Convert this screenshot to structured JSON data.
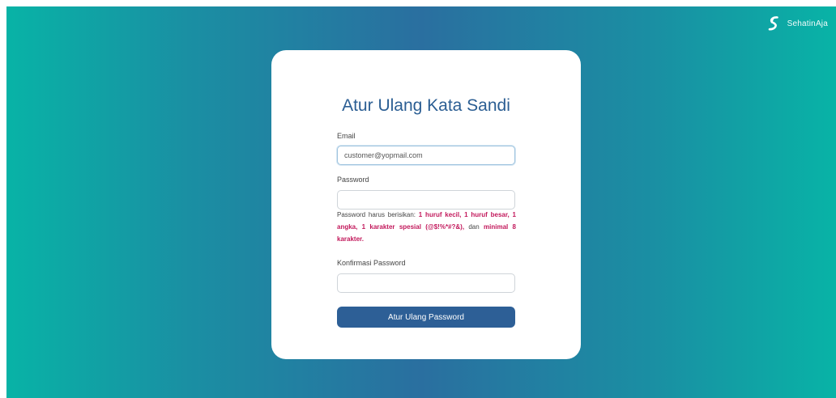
{
  "brand": {
    "name": "SehatinAja",
    "logo_icon": "s-logo-icon"
  },
  "form": {
    "title": "Atur Ulang Kata Sandi",
    "email": {
      "label": "Email",
      "value": "customer@yopmail.com",
      "placeholder": ""
    },
    "password": {
      "label": "Password",
      "value": "",
      "placeholder": ""
    },
    "hint": {
      "prefix": "Password harus berisikan: ",
      "requirements": "1 huruf kecil, 1 huruf besar, 1 angka, 1 karakter spesial (@$!%*#?&),",
      "connector": " dan ",
      "min_length": "minimal 8 karakter."
    },
    "confirm_password": {
      "label": "Konfirmasi Password",
      "value": "",
      "placeholder": ""
    },
    "submit_label": "Atur Ulang Password"
  },
  "colors": {
    "gradient_edge": "#08b3a6",
    "gradient_center": "#2a6fa0",
    "title": "#2b5e93",
    "button": "#2d5f96",
    "hint_emphasis": "#c2185b"
  }
}
